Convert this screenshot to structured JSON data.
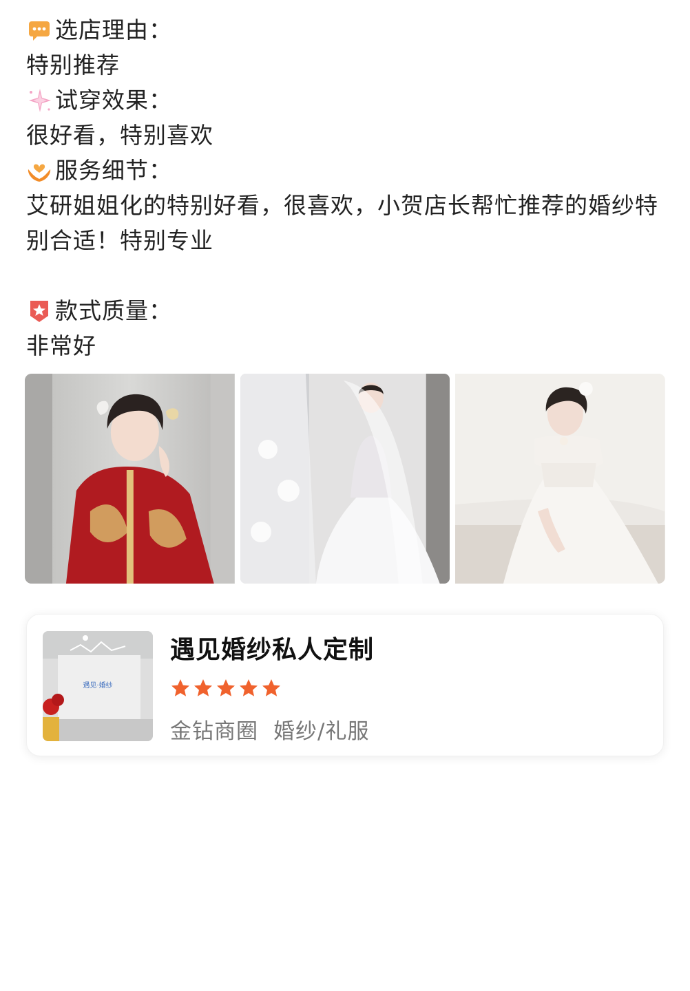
{
  "review": {
    "sections": [
      {
        "icon": "speech-bubble-icon",
        "title": "选店理由：",
        "body": "特别推荐"
      },
      {
        "icon": "sparkle-icon",
        "title": "试穿效果：",
        "body": "很好看，特别喜欢"
      },
      {
        "icon": "heart-hands-icon",
        "title": "服务细节：",
        "body": "艾研姐姐化的特别好看，很喜欢，小贺店长帮忙推荐的婚纱特别合适！特别专业"
      },
      {
        "icon": "star-badge-icon",
        "title": "款式质量：",
        "body": "非常好"
      }
    ]
  },
  "photos": [
    {
      "name": "bride-red-qungua-photo"
    },
    {
      "name": "bride-ballgown-veil-photo"
    },
    {
      "name": "bride-off-shoulder-gown-photo"
    }
  ],
  "shop": {
    "name": "遇见婚纱私人定制",
    "rating_stars": 5,
    "district": "金钻商圈",
    "category": "婚纱/礼服",
    "thumb_sign": "遇见·婚纱",
    "star_color": "#f0622d"
  }
}
